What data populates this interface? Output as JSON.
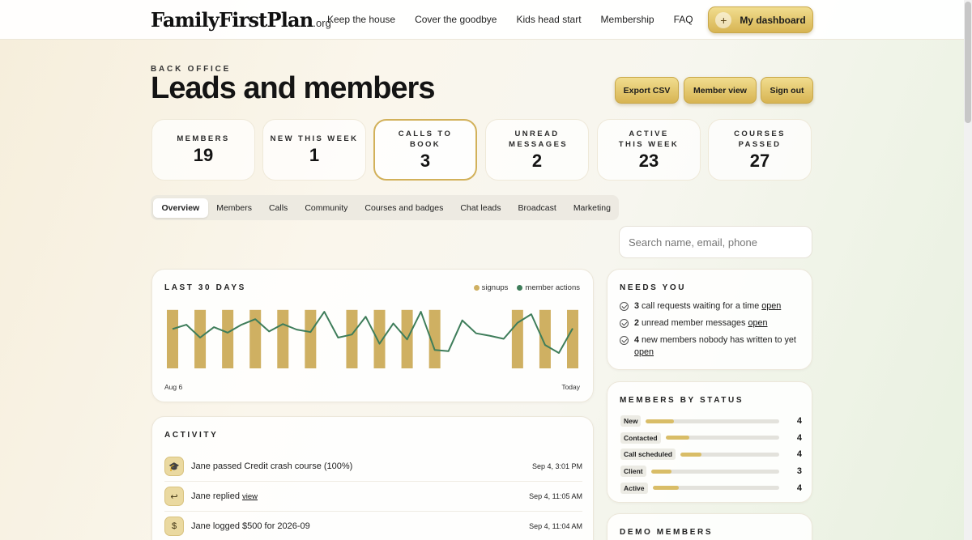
{
  "nav": {
    "logo": "FamilyFirstPlan",
    "logo_suffix": ".org",
    "links": [
      "Keep the house",
      "Cover the goodbye",
      "Kids head start",
      "Membership",
      "FAQ"
    ],
    "dashboard_label": "My dashboard"
  },
  "header": {
    "eyebrow": "BACK OFFICE",
    "title": "Leads and members",
    "actions": {
      "export": "Export CSV",
      "member_view": "Member view",
      "sign_out": "Sign out"
    }
  },
  "stats": [
    {
      "label": "MEMBERS",
      "value": "19"
    },
    {
      "label": "NEW THIS WEEK",
      "value": "1"
    },
    {
      "label": "CALLS TO BOOK",
      "value": "3"
    },
    {
      "label": "UNREAD MESSAGES",
      "value": "2"
    },
    {
      "label": "ACTIVE THIS WEEK",
      "value": "23"
    },
    {
      "label": "COURSES PASSED",
      "value": "27"
    }
  ],
  "tabs": [
    "Overview",
    "Members",
    "Calls",
    "Community",
    "Courses and badges",
    "Chat leads",
    "Broadcast",
    "Marketing"
  ],
  "search": {
    "placeholder": "Search name, email, phone"
  },
  "chart_data": {
    "type": "bar",
    "title": "LAST 30 DAYS",
    "x_start_label": "Aug 6",
    "x_end_label": "Today",
    "legend": [
      "signups",
      "member actions"
    ],
    "colors": {
      "signups": "#cfb062",
      "member_actions": "#3e7d5a"
    },
    "series": [
      {
        "name": "signups",
        "type": "bar",
        "values": [
          1,
          0,
          1,
          0,
          1,
          0,
          1,
          0,
          1,
          0,
          1,
          0,
          0,
          1,
          0,
          1,
          0,
          1,
          0,
          1,
          0,
          0,
          0,
          0,
          0,
          1,
          0,
          1,
          0,
          1
        ]
      },
      {
        "name": "member actions",
        "type": "line",
        "values": [
          0.64,
          0.71,
          0.5,
          0.67,
          0.58,
          0.71,
          0.8,
          0.6,
          0.72,
          0.63,
          0.59,
          0.92,
          0.5,
          0.55,
          0.84,
          0.4,
          0.73,
          0.47,
          0.92,
          0.3,
          0.28,
          0.78,
          0.57,
          0.53,
          0.48,
          0.74,
          0.88,
          0.38,
          0.25,
          0.65
        ]
      }
    ],
    "ylim": [
      0,
      1
    ]
  },
  "needs": {
    "title": "NEEDS YOU",
    "items": [
      {
        "count": "3",
        "text": "call requests waiting for a time",
        "link": "open"
      },
      {
        "count": "2",
        "text": "unread member messages",
        "link": "open"
      },
      {
        "count": "4",
        "text": "new members nobody has written to yet",
        "link": "open"
      }
    ]
  },
  "status": {
    "title": "MEMBERS BY STATUS",
    "max": 19,
    "rows": [
      {
        "label": "New",
        "count": 4
      },
      {
        "label": "Contacted",
        "count": 4
      },
      {
        "label": "Call scheduled",
        "count": 4
      },
      {
        "label": "Client",
        "count": 3
      },
      {
        "label": "Active",
        "count": 4
      }
    ]
  },
  "activity": {
    "title": "ACTIVITY",
    "items": [
      {
        "icon": "graduation-cap-icon",
        "glyph": "🎓",
        "text": "Jane passed Credit crash course (100%)",
        "link": "",
        "time": "Sep 4, 3:01 PM"
      },
      {
        "icon": "reply-icon",
        "glyph": "↩",
        "text": "Jane replied",
        "link": "view",
        "time": "Sep 4, 11:05 AM"
      },
      {
        "icon": "dollar-icon",
        "glyph": "$",
        "text": "Jane logged $500 for 2026-09",
        "link": "",
        "time": "Sep 4, 11:04 AM"
      }
    ]
  },
  "demo": {
    "title": "DEMO MEMBERS"
  }
}
